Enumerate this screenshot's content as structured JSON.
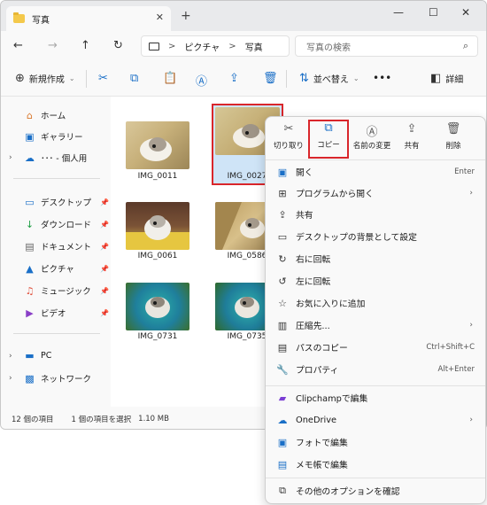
{
  "window": {
    "tab_title": "写真",
    "tab_close": "✕",
    "tab_add": "+",
    "controls": {
      "minimize": "—",
      "maximize": "☐",
      "close": "✕"
    }
  },
  "address": {
    "back": "←",
    "forward": "→",
    "up": "↑",
    "refresh": "↻",
    "crumb1": "ピクチャ",
    "crumb2": "写真",
    "separator": ">",
    "search_placeholder": "写真の検索"
  },
  "toolbar": {
    "new_label": "新規作成",
    "sort_label": "並べ替え",
    "more": "•••",
    "details_label": "詳細"
  },
  "sidebar": {
    "home": "ホーム",
    "gallery": "ギャラリー",
    "onedrive": "･･･ - 個人用",
    "desktop": "デスクトップ",
    "downloads": "ダウンロード",
    "documents": "ドキュメント",
    "pictures": "ピクチャ",
    "music": "ミュージック",
    "videos": "ビデオ",
    "pc": "PC",
    "network": "ネットワーク"
  },
  "files": [
    {
      "name": "IMG_0011"
    },
    {
      "name": "IMG_0027"
    },
    {
      "name": "IMG_0061"
    },
    {
      "name": "IMG_0586"
    },
    {
      "name": "IMG_0731"
    },
    {
      "name": "IMG_0735"
    }
  ],
  "status": {
    "count": "12 個の項目",
    "selected": "1 個の項目を選択",
    "size": "1.10 MB"
  },
  "context_menu": {
    "quick": [
      {
        "label": "切り取り",
        "icon": "scissors-icon"
      },
      {
        "label": "コピー",
        "icon": "copy-icon"
      },
      {
        "label": "名前の変更",
        "icon": "rename-icon"
      },
      {
        "label": "共有",
        "icon": "share-icon"
      },
      {
        "label": "削除",
        "icon": "trash-icon"
      }
    ],
    "items": [
      {
        "label": "開く",
        "shortcut": "Enter"
      },
      {
        "label": "プログラムから開く",
        "submenu": "›"
      },
      {
        "label": "共有"
      },
      {
        "label": "デスクトップの背景として設定"
      },
      {
        "label": "右に回転"
      },
      {
        "label": "左に回転"
      },
      {
        "label": "お気に入りに追加"
      },
      {
        "label": "圧縮先...",
        "submenu": "›"
      },
      {
        "label": "パスのコピー",
        "shortcut": "Ctrl+Shift+C"
      },
      {
        "label": "プロパティ",
        "shortcut": "Alt+Enter"
      },
      {
        "label": "Clipchampで編集"
      },
      {
        "label": "OneDrive",
        "submenu": "›"
      },
      {
        "label": "フォトで編集"
      },
      {
        "label": "メモ帳で編集"
      },
      {
        "label": "その他のオプションを確認"
      }
    ]
  },
  "colors": {
    "accent": "#1a6fc7",
    "highlight_border": "#d9262b",
    "selection": "#cfe4f7"
  }
}
